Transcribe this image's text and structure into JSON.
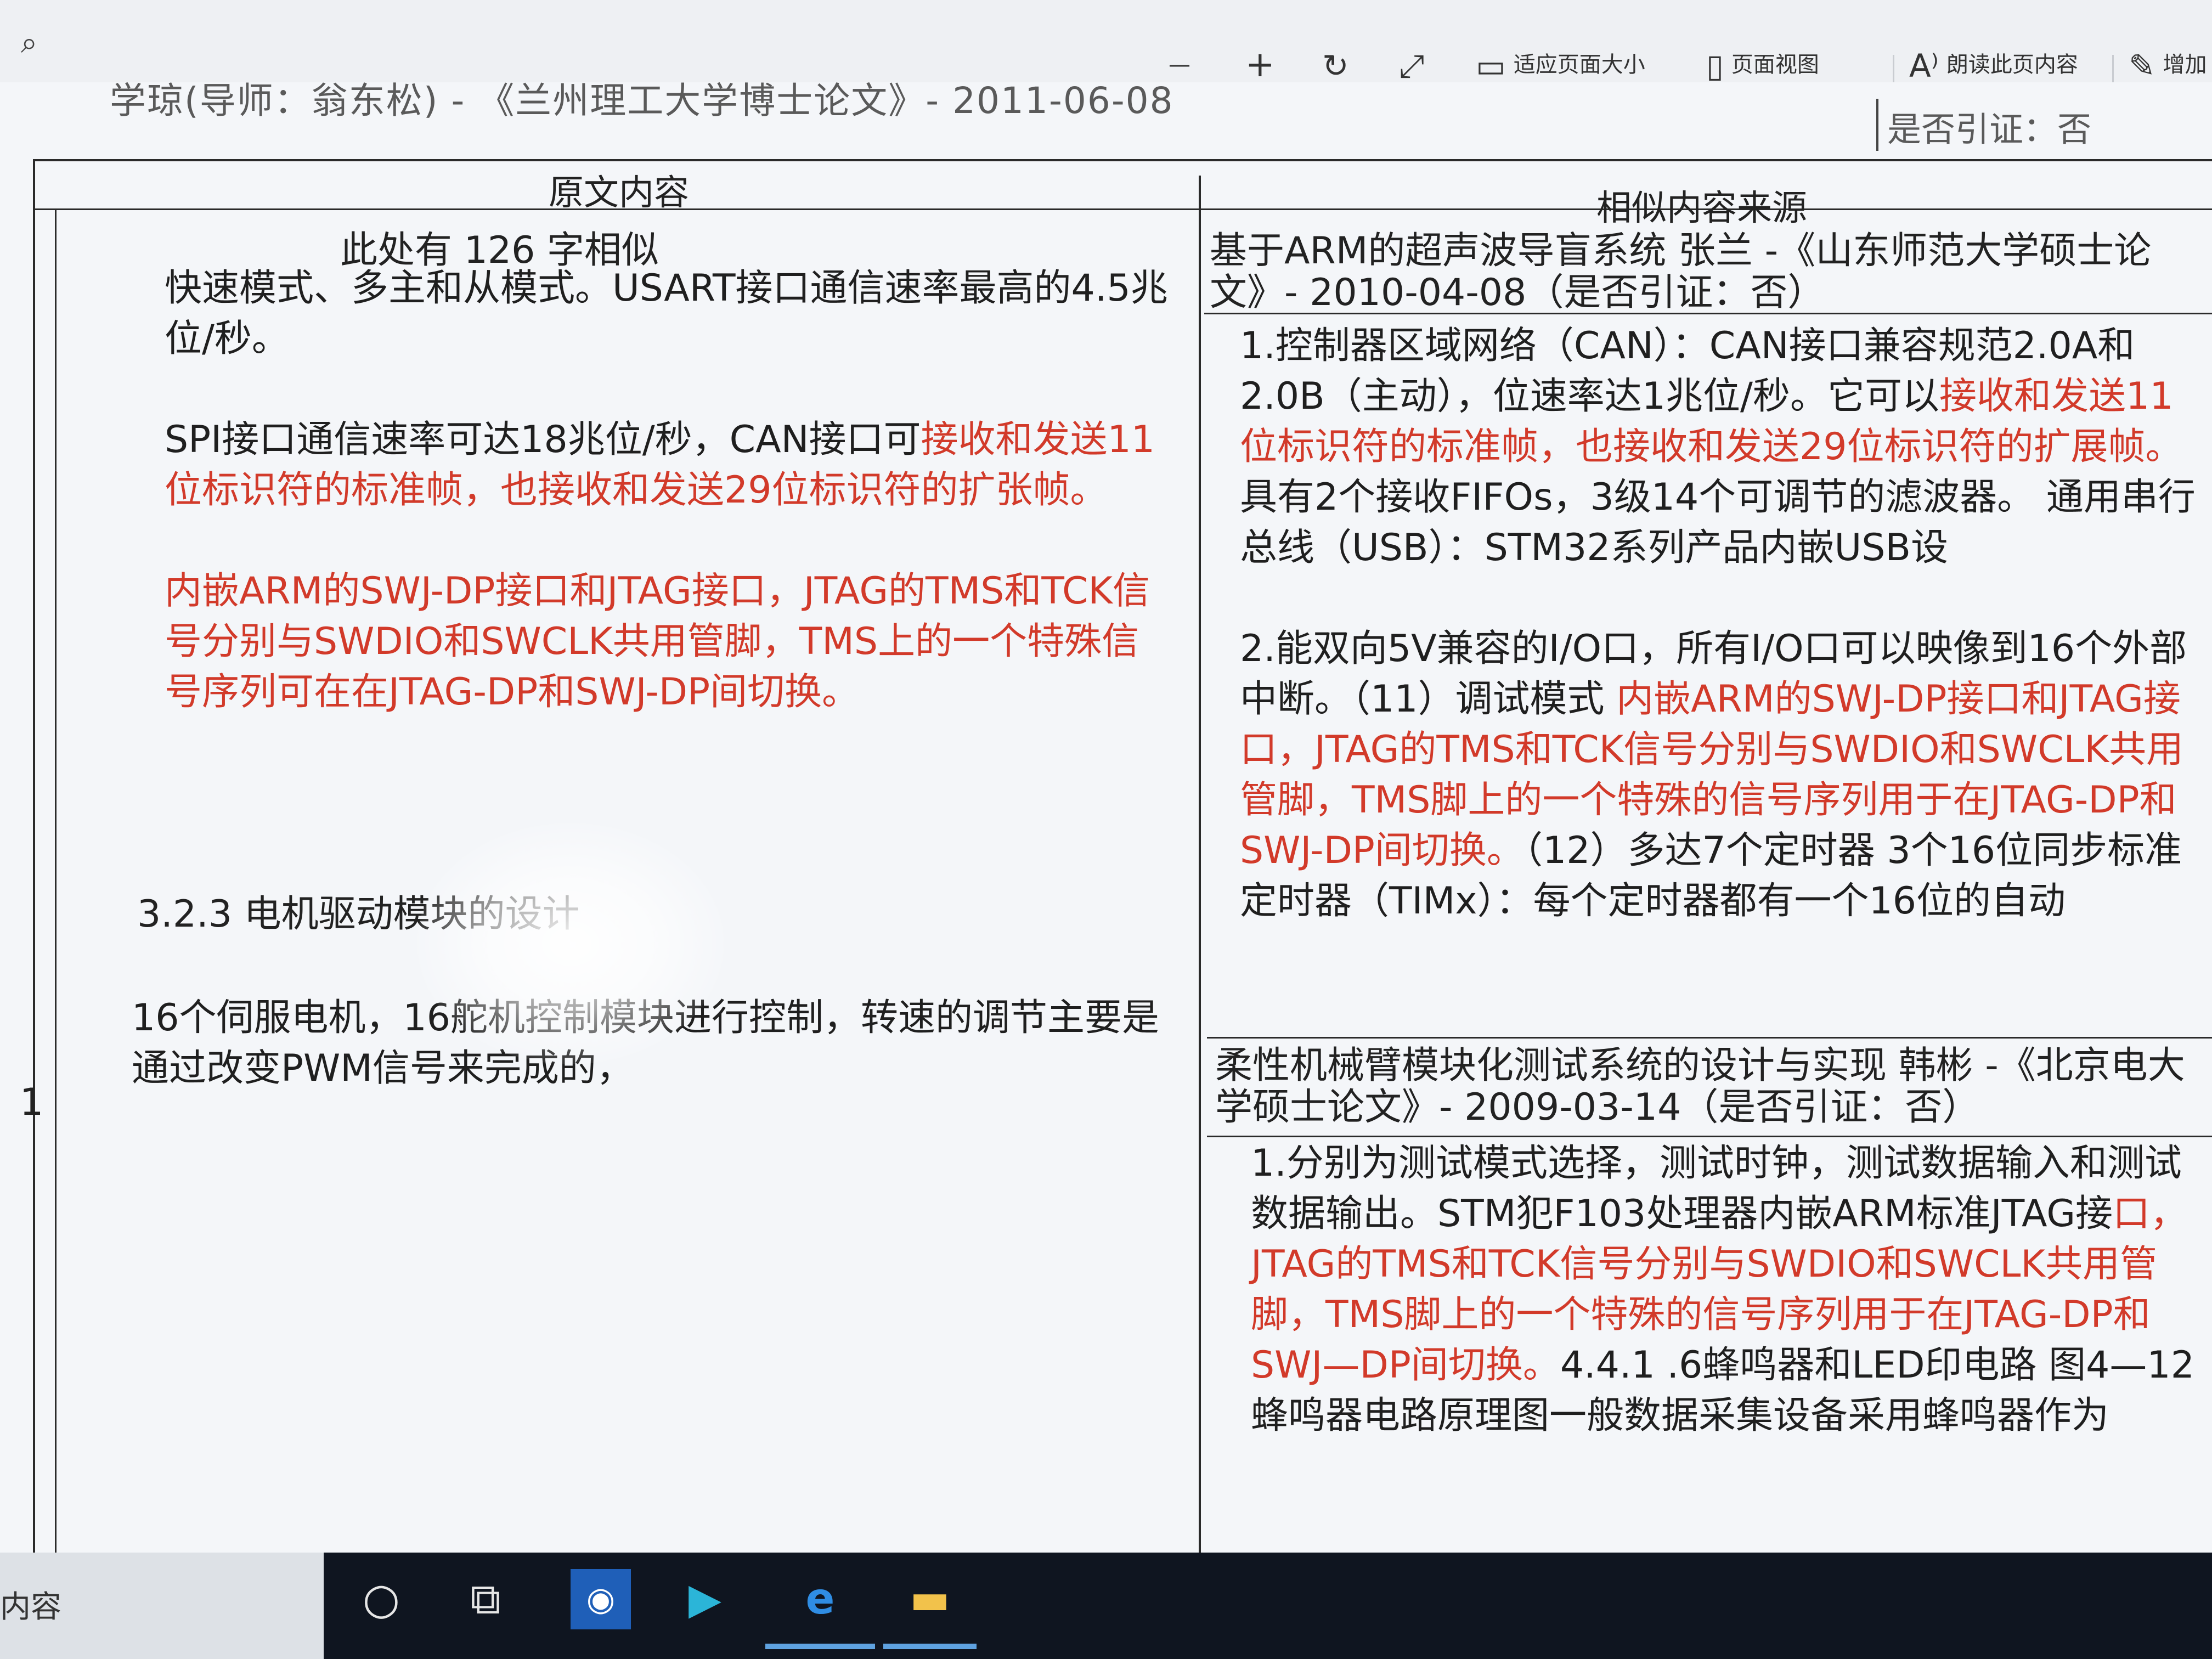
{
  "toolbar": {
    "zoom_out": "—",
    "zoom_in": "+",
    "fit_page_label": "适应页面大小",
    "page_view_label": "页面视图",
    "read_aloud_label": "朗读此页内容",
    "add_notes_label": "增加"
  },
  "doc_header": {
    "left_text": "学琼(导师：翁东松) - 《兰州理工大学博士论文》- 2011-06-08",
    "right_text": "是否引证：否"
  },
  "table": {
    "col_original": "原文内容",
    "col_sources": "相似内容来源",
    "row_number": "1",
    "similar_count": "此处有 126 字相似",
    "original_paragraphs": [
      {
        "text": "快速模式、多主和从模式。USART接口通信速率最高的4.5兆位/秒。"
      },
      {
        "prefix": "SPI接口通信速率可达18兆位/秒，CAN接口可",
        "highlight": "接收和发送11位标识符的标准帧，也接收和发送29位标识符的扩张帧。"
      },
      {
        "highlight": "内嵌ARM的SWJ-DP接口和JTAG接口，JTAG的TMS和TCK信号分别与SWDIO和SWCLK共用管脚，TMS上的一个特殊信号序列可在在JTAG-DP和SWJ-DP间切换。"
      }
    ],
    "section_title": "3.2.3 电机驱动模块的设计",
    "last_paragraph": "16个伺服电机，16舵机控制模块进行控制，转速的调节主要是通过改变PWM信号来完成的，",
    "sources": [
      {
        "title": "基于ARM的超声波导盲系统 张兰 -《山东师范大学硕士论文》- 2010-04-08（是否引证：否）",
        "excerpts": [
          {
            "prefix": "1.控制器区域网络（CAN）：CAN接口兼容规范2.0A和2.0B（主动），位速率达1兆位/秒。它可以",
            "highlight": "接收和发送11位标识符的标准帧，也接收和发送29位标识符的扩展帧。",
            "suffix": "具有2个接收FIFOs，3级14个可调节的滤波器。 通用串行总线（USB）：STM32系列产品内嵌USB设"
          },
          {
            "prefix": "2.能双向5V兼容的I/O口，所有I/O口可以映像到16个外部中断。（11）调试模式 ",
            "highlight": "内嵌ARM的SWJ-DP接口和JTAG接口，JTAG的TMS和TCK信号分别与SWDIO和SWCLK共用管脚，TMS脚上的一个特殊的信号序列用于在JTAG-DP和SWJ-DP间切换。",
            "suffix": "（12）多达7个定时器 3个16位同步标准定时器（TIMx）：每个定时器都有一个16位的自动"
          }
        ]
      },
      {
        "title": "柔性机械臂模块化测试系统的设计与实现 韩彬 -《北京电大学硕士论文》- 2009-03-14（是否引证：否）",
        "excerpts": [
          {
            "prefix": "1.分别为测试模式选择，测试时钟，测试数据输入和测试数据输出。STM犯F103处理器内嵌ARM标准JTAG接",
            "highlight": "口，JTAG的TMS和TCK信号分别与SWDIO和SWCLK共用管脚，TMS脚上的一个特殊的信号序列用于在JTAG-DP和SWJ—DP间切换。",
            "suffix": "4.4.1 .6蜂鸣器和LED印电路 图4—12蜂鸣器电路原理图一般数据采集设备采用蜂鸣器作为"
          }
        ]
      }
    ]
  },
  "taskbar": {
    "search_text": "内容",
    "icons": [
      "cortana-icon",
      "task-view-icon",
      "app-icon",
      "media-player-icon",
      "edge-icon",
      "file-explorer-icon"
    ]
  },
  "colors": {
    "highlight_red": "#d23a2a",
    "taskbar_bg": "#0f1520"
  }
}
